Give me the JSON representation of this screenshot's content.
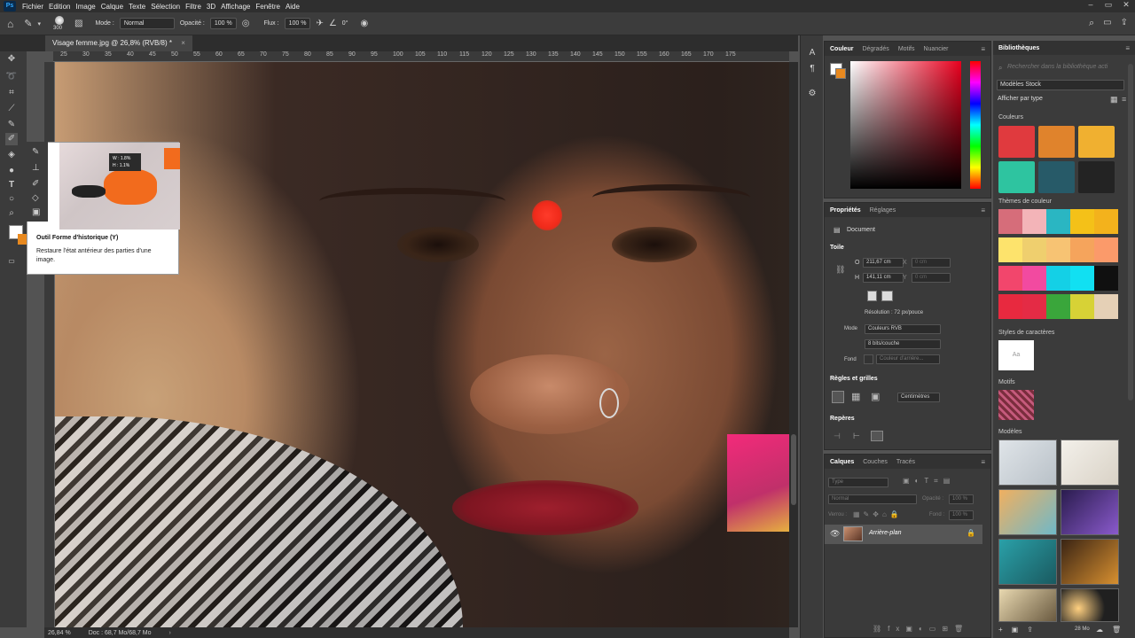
{
  "menu": {
    "items": [
      "Fichier",
      "Edition",
      "Image",
      "Calque",
      "Texte",
      "Sélection",
      "Filtre",
      "3D",
      "Affichage",
      "Fenêtre",
      "Aide"
    ]
  },
  "options": {
    "brush_size": "300",
    "mode_label": "Mode :",
    "mode_value": "Normal",
    "opacity_label": "Opacité :",
    "opacity_value": "100 %",
    "flux_label": "Flux :",
    "flux_value": "100 %",
    "angle_value": "0°"
  },
  "document": {
    "tab_title": "Visage femme.jpg @ 26,8% (RVB/8) *",
    "zoom": "26,84 %",
    "doc_size": "Doc : 68,7 Mo/68,7 Mo"
  },
  "ruler": {
    "ticks": [
      "25",
      "30",
      "35",
      "40",
      "45",
      "50",
      "55",
      "60",
      "65",
      "70",
      "75",
      "80",
      "85",
      "90",
      "95",
      "100",
      "105",
      "110",
      "115",
      "120",
      "125",
      "130",
      "135",
      "140",
      "145",
      "150",
      "155",
      "160",
      "165",
      "170",
      "175"
    ]
  },
  "tooltip": {
    "title": "Outil Forme d'historique (Y)",
    "description": "Restaure l'état antérieur des parties d'une image.",
    "w": "W : 1.8%",
    "h": "H : 1.1%"
  },
  "color_panel": {
    "tabs": [
      "Couleur",
      "Dégradés",
      "Motifs",
      "Nuancier"
    ],
    "fg": "#ffffff",
    "bg": "#e8891f"
  },
  "properties": {
    "tabs": [
      "Propriétés",
      "Réglages"
    ],
    "doc_label": "Document",
    "toile": "Toile",
    "w_label": "O",
    "w_value": "211,67 cm",
    "x_label": "X",
    "x_value": "0 cm",
    "h_label": "H",
    "h_value": "141,11 cm",
    "y_label": "Y",
    "y_value": "0 cm",
    "resolution": "Résolution : 72 px/pouce",
    "mode_label": "Mode",
    "mode_value": "Couleurs RVB",
    "depth_value": "8 bits/couche",
    "fond_label": "Fond",
    "fond_value": "Couleur d'arrière...",
    "regles": "Règles et grilles",
    "units": "Centimètres",
    "reperes": "Repères"
  },
  "layers": {
    "tabs": [
      "Calques",
      "Couches",
      "Tracés"
    ],
    "search_placeholder": "Type",
    "blend": "Normal",
    "opacity_label": "Opacité :",
    "opacity_value": "100 %",
    "lock_label": "Verrou :",
    "fill_label": "Fond :",
    "fill_value": "100 %",
    "layer_name": "Arrière-plan"
  },
  "library": {
    "title": "Bibliothèques",
    "search_placeholder": "Rechercher dans la bibliothèque acti",
    "stock": "Modèles Stock",
    "show_by": "Afficher par type",
    "couleurs": "Couleurs",
    "themes": "Thèmes de couleur",
    "styles": "Styles de caractères",
    "style_sample": "Aa",
    "motifs": "Motifs",
    "modeles": "Modèles",
    "size": "28 Mo",
    "colors": [
      "#e03a3e",
      "#e0832c",
      "#f0b030",
      "#2ec4a0",
      "#275a68",
      "#232323"
    ],
    "themes_rows": [
      [
        "#d66d7a",
        "#f3b4b8",
        "#2ab6c2",
        "#f4c118",
        "#f3b21c"
      ],
      [
        "#fde36c",
        "#efcf6e",
        "#f7c373",
        "#f5a45c",
        "#fb9a6a"
      ],
      [
        "#f2466c",
        "#f24aa0",
        "#14d0e6",
        "#11e0f2",
        "#101010"
      ],
      [
        "#e8293f",
        "#e42b45",
        "#3aa63b",
        "#d7d236",
        "#e5d0b6"
      ]
    ]
  }
}
